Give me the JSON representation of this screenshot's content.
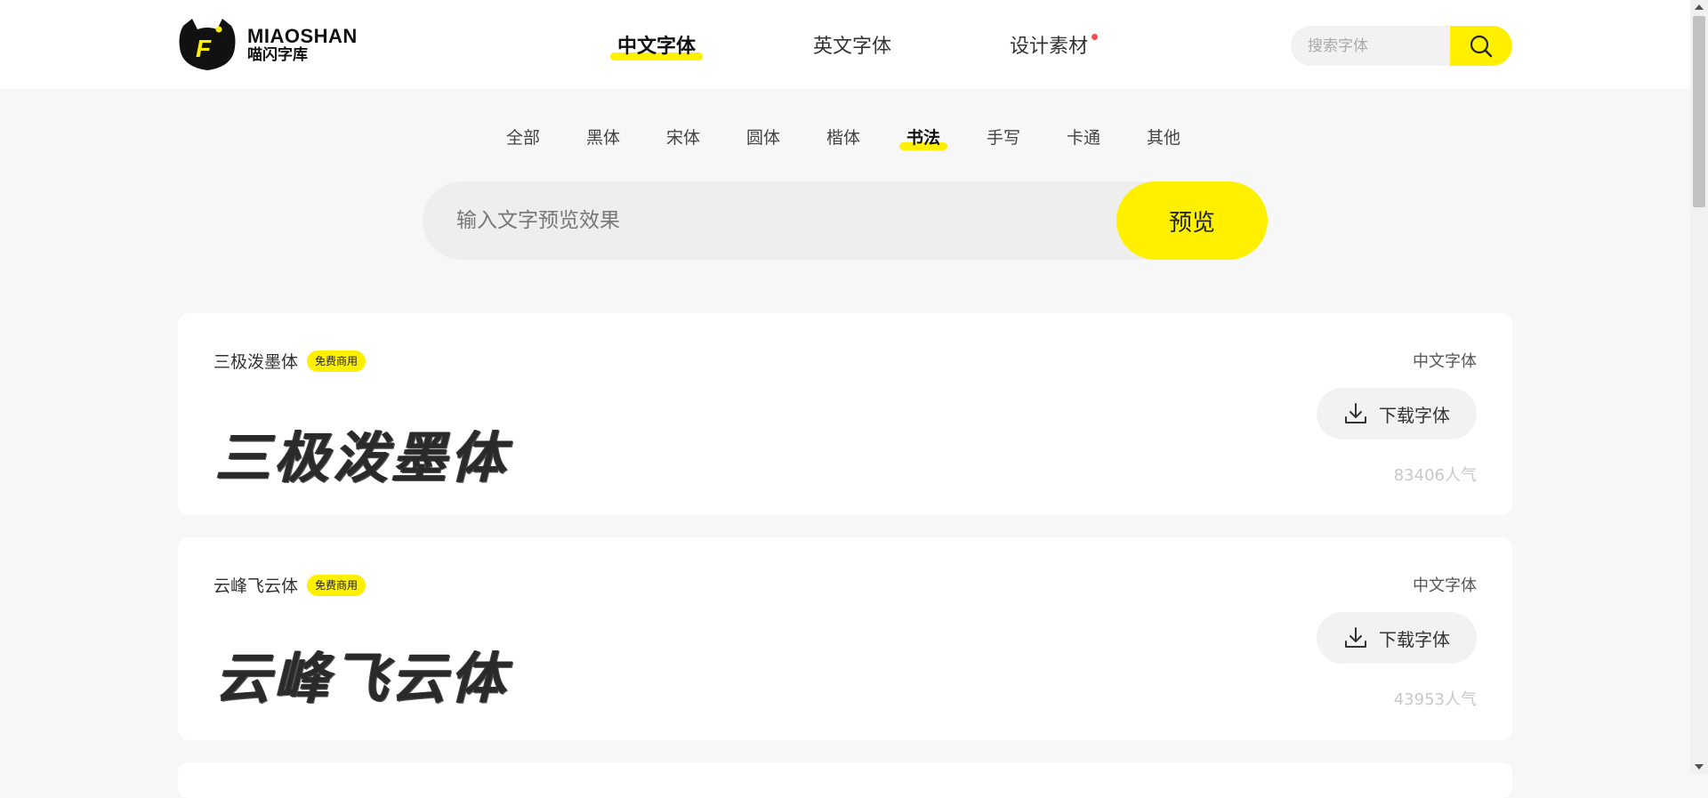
{
  "header": {
    "logo_en": "MIAOSHAN",
    "logo_cn": "喵闪字库",
    "logo_letter": "F",
    "nav": [
      {
        "label": "中文字体",
        "active": true
      },
      {
        "label": "英文字体",
        "active": false
      },
      {
        "label": "设计素材",
        "active": false,
        "dot": true
      }
    ],
    "search_placeholder": "搜索字体"
  },
  "categories": [
    {
      "label": "全部"
    },
    {
      "label": "黑体"
    },
    {
      "label": "宋体"
    },
    {
      "label": "圆体"
    },
    {
      "label": "楷体"
    },
    {
      "label": "书法",
      "active": true
    },
    {
      "label": "手写"
    },
    {
      "label": "卡通"
    },
    {
      "label": "其他"
    }
  ],
  "preview": {
    "placeholder": "输入文字预览效果",
    "button": "预览"
  },
  "fonts": [
    {
      "name": "三极泼墨体",
      "badge": "免费商用",
      "sample": "三极泼墨体",
      "category": "中文字体",
      "download_label": "下载字体",
      "popularity": "83406人气"
    },
    {
      "name": "云峰飞云体",
      "badge": "免费商用",
      "sample": "云峰飞云体",
      "category": "中文字体",
      "download_label": "下载字体",
      "popularity": "43953人气"
    }
  ],
  "colors": {
    "accent": "#fff000",
    "badge_dot": "#ff4d4f"
  }
}
